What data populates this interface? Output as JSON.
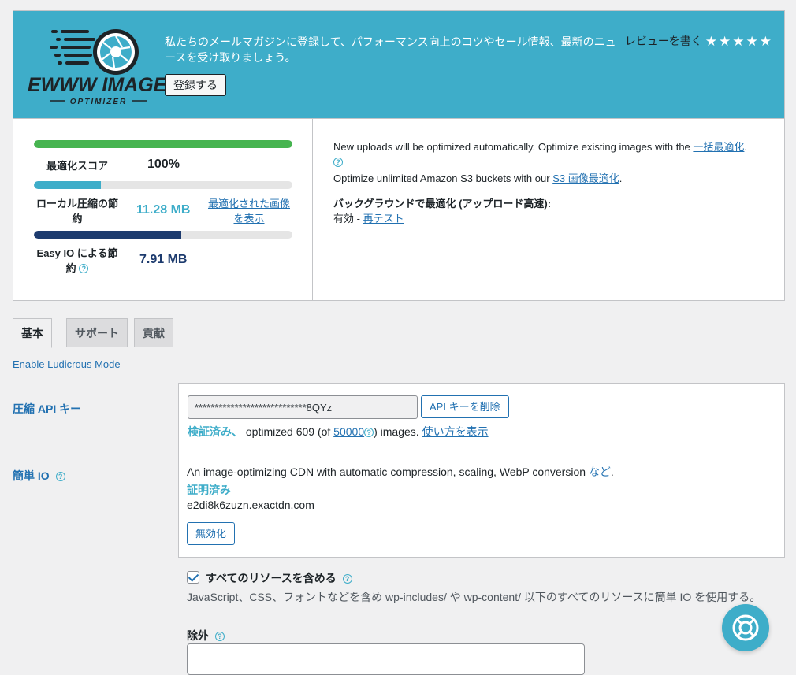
{
  "banner": {
    "logo_text": "EWWW IMAGE",
    "logo_subtext": "OPTIMIZER",
    "message": "私たちのメールマガジンに登録して、パフォーマンス向上のコツやセール情報、最新のニュースを受け取りましょう。",
    "subscribe_label": "登録する",
    "review_label": "レビューを書く",
    "stars": [
      "★",
      "★",
      "★",
      "★",
      "★"
    ]
  },
  "stats": {
    "score": {
      "label": "最適化スコア",
      "value": "100%",
      "percent": 100,
      "color": "#46b450"
    },
    "local": {
      "label": "ローカル圧縮の節約",
      "value": "11.28 MB",
      "link": "最適化された画像を表示",
      "percent": 26,
      "color": "#3eadc9"
    },
    "easyio": {
      "label": "Easy IO による節約",
      "value": "7.91 MB",
      "percent": 57,
      "color": "#1d3b6e"
    }
  },
  "info": {
    "line1_prefix": "New uploads will be optimized automatically. Optimize existing images with the ",
    "line1_link": "一括最適化",
    "line1_suffix": ".",
    "line2_prefix": "Optimize unlimited Amazon S3 buckets with our ",
    "line2_link": "S3 画像最適化",
    "line2_suffix": ".",
    "bg_title": "バックグラウンドで最適化 (アップロード高速):",
    "bg_status": "有効 - ",
    "bg_retest": "再テスト"
  },
  "tabs": [
    "基本",
    "サポート",
    "貢献"
  ],
  "ludicrous_label": "Enable Ludicrous Mode",
  "api": {
    "label": "圧縮 API キー",
    "key_value": "****************************8QYz",
    "delete_label": "API キーを削除",
    "verified": "検証済み、",
    "usage_prefix": " optimized 609 (of ",
    "usage_limit": "50000",
    "usage_suffix": ") images. ",
    "howto_link": "使い方を表示"
  },
  "easyio": {
    "label": "簡単 IO",
    "desc_prefix": "An image-optimizing CDN with automatic compression, scaling, WebP conversion ",
    "desc_link": "など",
    "desc_suffix": ".",
    "verified": "証明済み",
    "domain": "e2di8k6zuzn.exactdn.com",
    "disable_label": "無効化"
  },
  "include_all": {
    "label": "すべてのリソースを含める",
    "description": "JavaScript、CSS、フォントなどを含め wp-includes/ や wp-content/ 以下のすべてのリソースに簡単 IO を使用する。",
    "checked": true
  },
  "exclude": {
    "label": "除外"
  },
  "qmark": "?"
}
